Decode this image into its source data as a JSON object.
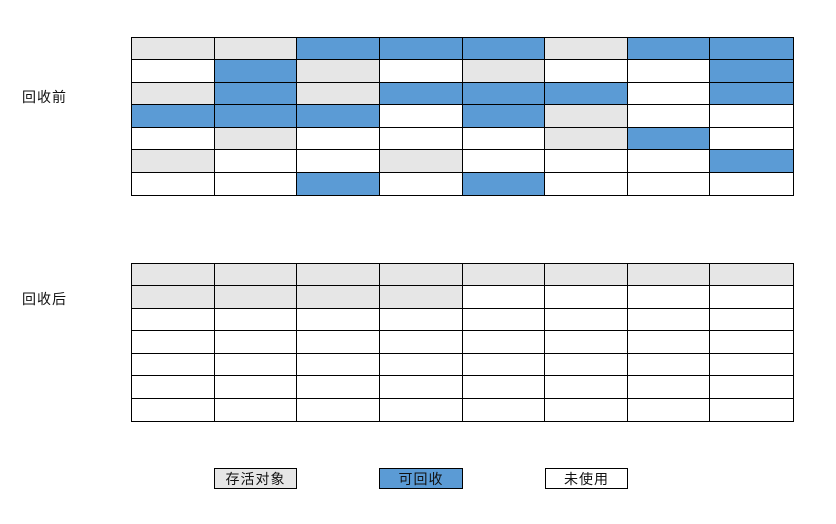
{
  "labels": {
    "before": "回收前",
    "after": "回收后"
  },
  "colors": {
    "live": "#e6e6e6",
    "reclaimable": "#5b9bd5",
    "unused": "#ffffff"
  },
  "legend": [
    {
      "key": "L",
      "label": "存活对象"
    },
    {
      "key": "R",
      "label": "可回收"
    },
    {
      "key": "U",
      "label": "未使用"
    }
  ],
  "grid_before": [
    [
      "L",
      "L",
      "R",
      "R",
      "R",
      "L",
      "R",
      "R"
    ],
    [
      "U",
      "R",
      "L",
      "U",
      "L",
      "U",
      "U",
      "R"
    ],
    [
      "L",
      "R",
      "L",
      "R",
      "R",
      "R",
      "U",
      "R"
    ],
    [
      "R",
      "R",
      "R",
      "U",
      "R",
      "L",
      "U",
      "U"
    ],
    [
      "U",
      "L",
      "U",
      "U",
      "U",
      "L",
      "R",
      "U"
    ],
    [
      "L",
      "U",
      "U",
      "L",
      "U",
      "U",
      "U",
      "R"
    ],
    [
      "U",
      "U",
      "R",
      "U",
      "R",
      "U",
      "U",
      "U"
    ]
  ],
  "grid_after": [
    [
      "L",
      "L",
      "L",
      "L",
      "L",
      "L",
      "L",
      "L"
    ],
    [
      "L",
      "L",
      "L",
      "L",
      "U",
      "U",
      "U",
      "U"
    ],
    [
      "U",
      "U",
      "U",
      "U",
      "U",
      "U",
      "U",
      "U"
    ],
    [
      "U",
      "U",
      "U",
      "U",
      "U",
      "U",
      "U",
      "U"
    ],
    [
      "U",
      "U",
      "U",
      "U",
      "U",
      "U",
      "U",
      "U"
    ],
    [
      "U",
      "U",
      "U",
      "U",
      "U",
      "U",
      "U",
      "U"
    ],
    [
      "U",
      "U",
      "U",
      "U",
      "U",
      "U",
      "U",
      "U"
    ]
  ]
}
